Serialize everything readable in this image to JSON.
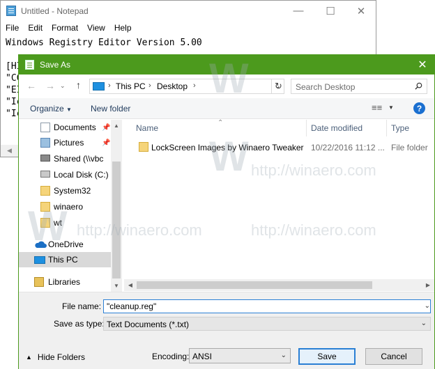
{
  "notepad": {
    "title": "Untitled - Notepad",
    "menu": [
      "File",
      "Edit",
      "Format",
      "View",
      "Help"
    ],
    "line1": "Windows Registry Editor Version 5.00",
    "fragments": [
      "[HI",
      "\"CC",
      "\"EI",
      "\"Ic",
      "\"Ic"
    ]
  },
  "watermark": {
    "letter": "W",
    "url": "http://winaero.com"
  },
  "dialog": {
    "title": "Save As",
    "address": {
      "items": [
        "This PC",
        "Desktop"
      ]
    },
    "search_placeholder": "Search Desktop",
    "toolbar": {
      "organize": "Organize",
      "new_folder": "New folder"
    },
    "nav_pane": [
      {
        "label": "Documents",
        "icon": "documents-icon",
        "pinned": true
      },
      {
        "label": "Pictures",
        "icon": "pictures-icon",
        "pinned": true
      },
      {
        "label": "Shared (\\\\vbc",
        "icon": "network-drive-icon",
        "pinned": false
      },
      {
        "label": "Local Disk (C:)",
        "icon": "disk-icon",
        "pinned": false
      },
      {
        "label": "System32",
        "icon": "folder-icon",
        "pinned": false
      },
      {
        "label": "winaero",
        "icon": "folder-icon",
        "pinned": false
      },
      {
        "label": "wt",
        "icon": "folder-icon",
        "pinned": false
      },
      {
        "label": "OneDrive",
        "icon": "onedrive-icon",
        "pinned": false
      },
      {
        "label": "This PC",
        "icon": "this-pc-icon",
        "pinned": false,
        "selected": true
      },
      {
        "label": "Libraries",
        "icon": "libraries-icon",
        "pinned": false
      }
    ],
    "columns": {
      "name": "Name",
      "date_modified": "Date modified",
      "type": "Type"
    },
    "files": [
      {
        "name": "LockScreen Images by Winaero Tweaker",
        "date_modified": "10/22/2016 11:12 ...",
        "type": "File folder"
      }
    ],
    "form": {
      "file_name_label": "File name:",
      "file_name_value": "\"cleanup.reg\"",
      "save_as_type_label": "Save as type:",
      "save_as_type_value": "Text Documents (*.txt)",
      "encoding_label": "Encoding:",
      "encoding_value": "ANSI",
      "hide_folders": "Hide Folders",
      "save": "Save",
      "cancel": "Cancel"
    }
  },
  "colors": {
    "dialog_accent": "#4c9a1d",
    "focus_blue": "#2a7fd4",
    "help_blue": "#1a6fd0"
  }
}
